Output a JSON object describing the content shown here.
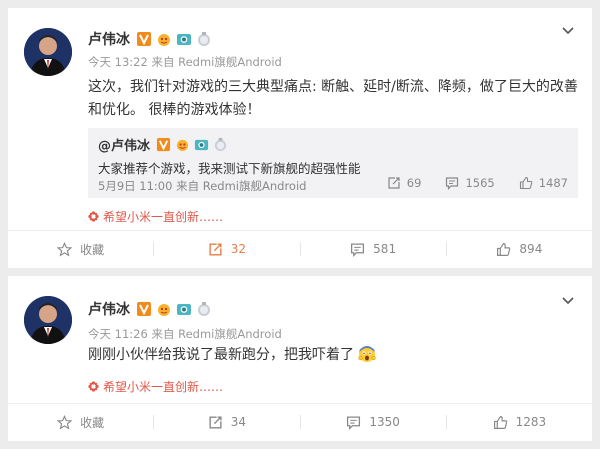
{
  "posts": [
    {
      "author": "卢伟冰",
      "time": "今天 13:22",
      "source_prefix": "来自",
      "source": "Redmi旗舰Android",
      "text": "这次，我们针对游戏的三大典型痛点: 断触、延时/断流、降频，做了巨大的改善和优化。 很棒的游戏体验！",
      "quote": {
        "author": "@卢伟冰",
        "text": "大家推荐个游戏，我来测试下新旗舰的超强性能",
        "time": "5月9日 11:00",
        "source_prefix": "来自",
        "source": "Redmi旗舰Android",
        "reposts": "69",
        "comments": "1565",
        "likes": "1487"
      },
      "footnote": "希望小米一直创新……",
      "actions": {
        "favorite": "收藏",
        "repost": "32",
        "comment": "581",
        "like": "894"
      }
    },
    {
      "author": "卢伟冰",
      "time": "今天 11:26",
      "source_prefix": "来自",
      "source": "Redmi旗舰Android",
      "text": "刚刚小伙伴给我说了最新跑分，把我吓着了",
      "text_emoji": "scared-face-icon",
      "footnote": "希望小米一直创新……",
      "actions": {
        "favorite": "收藏",
        "repost": "34",
        "comment": "1350",
        "like": "1283"
      }
    }
  ],
  "colors": {
    "highlight": "#e87e48",
    "footnote": "#e0584a",
    "quote_bg": "#f2f2f5",
    "vip_badge": "#f28b1c"
  }
}
